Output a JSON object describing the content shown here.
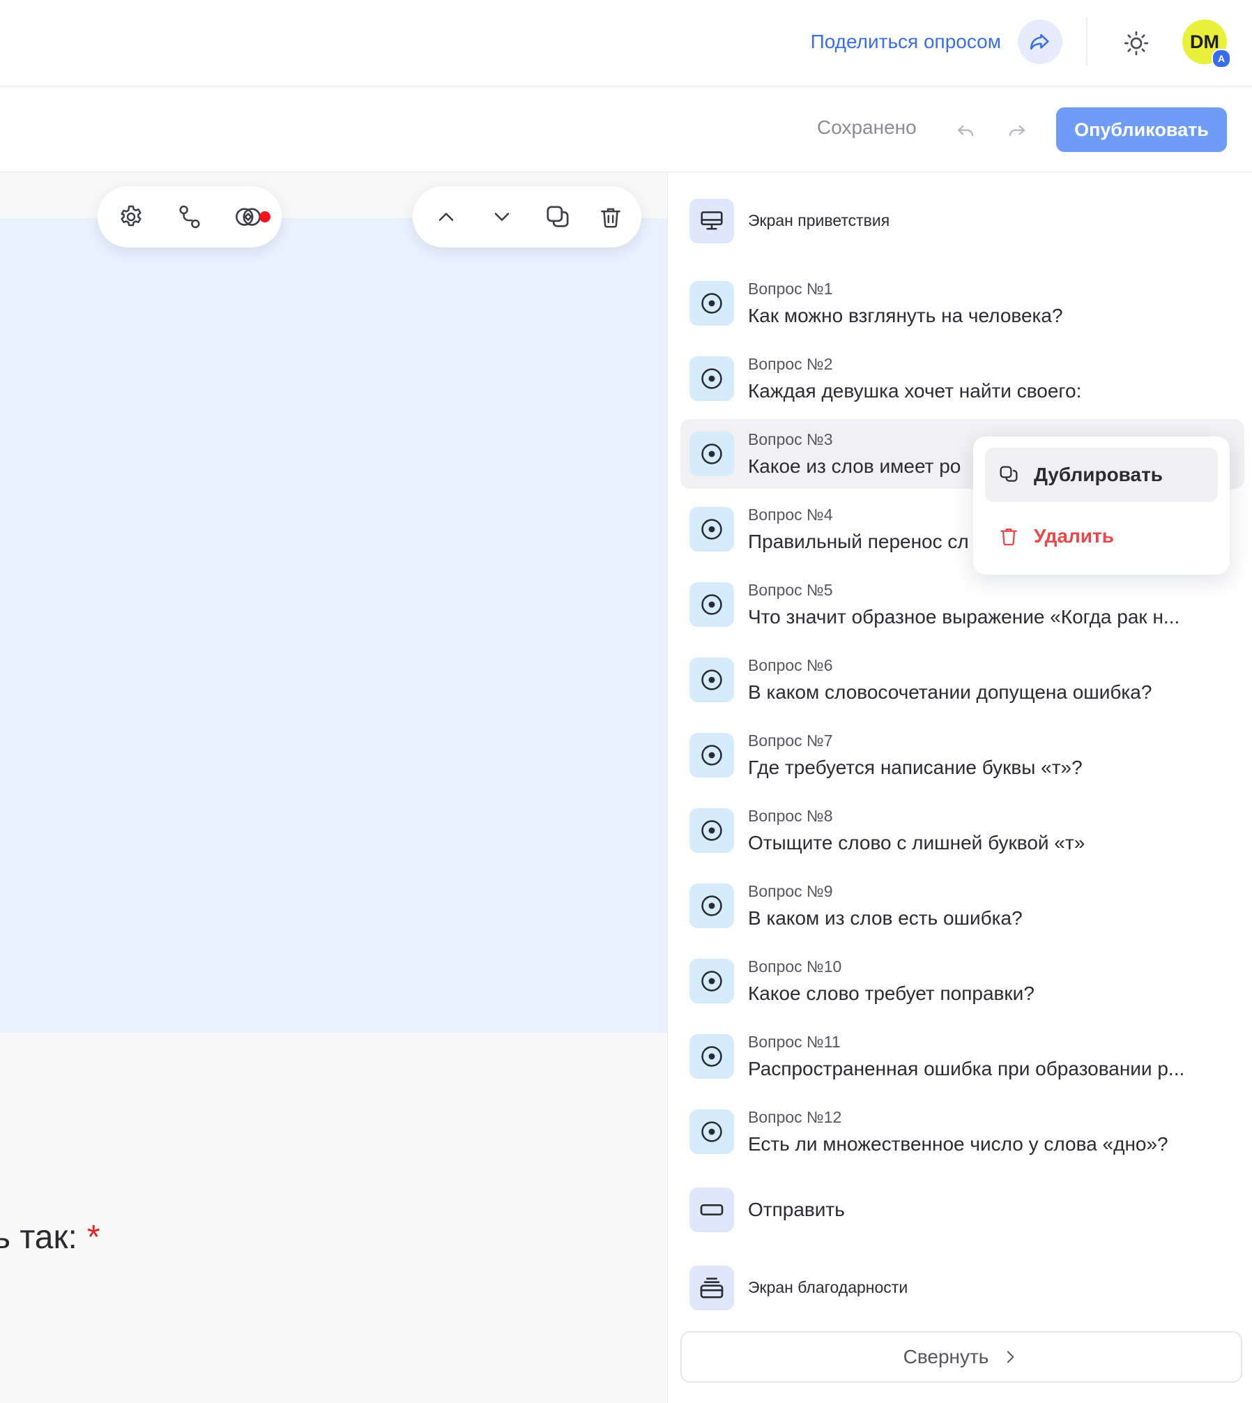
{
  "header": {
    "share_link": "Поделиться опросом",
    "avatar_initials": "DM",
    "avatar_badge": "A"
  },
  "toolbar": {
    "saved_status": "Сохранено",
    "publish_label": "Опубликовать"
  },
  "canvas": {
    "question_fragment": "ь так:",
    "required_mark": "*"
  },
  "panel": {
    "welcome_label": "Экран приветствия",
    "questions": [
      {
        "num": "Вопрос №1",
        "title": "Как можно взглянуть на человека?"
      },
      {
        "num": "Вопрос №2",
        "title": "Каждая девушка хочет найти своего:"
      },
      {
        "num": "Вопрос №3",
        "title": "Какое из слов имеет ро"
      },
      {
        "num": "Вопрос №4",
        "title": "Правильный перенос сл"
      },
      {
        "num": "Вопрос №5",
        "title": "Что значит образное выражение «Когда рак н..."
      },
      {
        "num": "Вопрос №6",
        "title": "В каком словосочетании допущена ошибка?"
      },
      {
        "num": "Вопрос №7",
        "title": "Где требуется написание буквы «т»?"
      },
      {
        "num": "Вопрос №8",
        "title": "Отыщите слово с лишней буквой «т»"
      },
      {
        "num": "Вопрос №9",
        "title": "В каком из слов есть ошибка?"
      },
      {
        "num": "Вопрос №10",
        "title": "Какое слово требует поправки?"
      },
      {
        "num": "Вопрос №11",
        "title": "Распространенная ошибка при образовании р..."
      },
      {
        "num": "Вопрос №12",
        "title": "Есть ли множественное число у слова «дно»?"
      }
    ],
    "submit_label": "Отправить",
    "thanks_label": "Экран благодарности",
    "collapse_label": "Свернуть"
  },
  "context_menu": {
    "duplicate_label": "Дублировать",
    "delete_label": "Удалить"
  },
  "colors": {
    "accent": "#3a6ee8",
    "publish": "#6f9cf5",
    "avatar": "#e9ef3b",
    "danger": "#e5484d",
    "slide_bg": "#e9f1fe",
    "question_icon_bg": "#d4ecfb"
  }
}
